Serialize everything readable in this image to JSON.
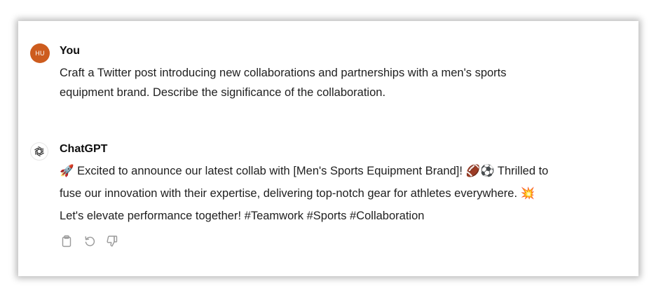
{
  "conversation": {
    "user": {
      "avatar_initials": "HU",
      "avatar_color": "#cd5c1e",
      "name": "You",
      "message_line1": "Craft a Twitter post introducing new collaborations and partnerships with a men's sports",
      "message_line2": "equipment brand. Describe the significance of the collaboration."
    },
    "assistant": {
      "icon": "openai-logo-icon",
      "name": "ChatGPT",
      "emoji_rocket": "🚀",
      "line1_a": " Excited to announce our latest collab with [Men's Sports Equipment Brand]! ",
      "emoji_football": "🏈",
      "emoji_soccer": "⚽",
      "line1_b": " Thrilled to",
      "line2_a": "fuse our innovation with their expertise, delivering top-notch gear for athletes everywhere. ",
      "emoji_burst": "💥",
      "line3": "Let's elevate performance together! #Teamwork #Sports #Collaboration",
      "actions": {
        "copy_icon": "clipboard-icon",
        "regenerate_icon": "regenerate-icon",
        "dislike_icon": "thumbs-down-icon"
      }
    }
  }
}
